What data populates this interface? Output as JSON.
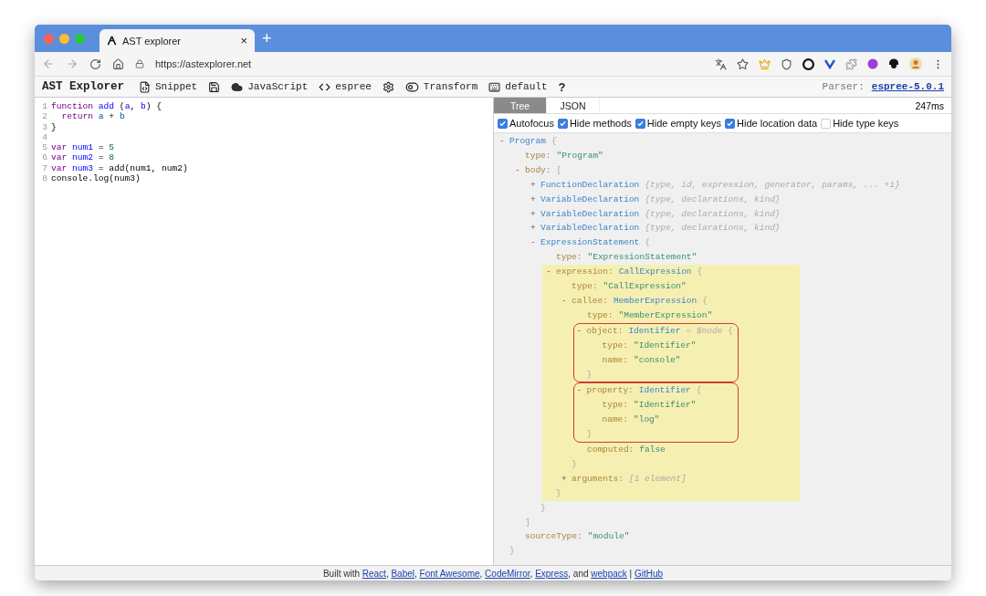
{
  "browser": {
    "tab": {
      "title": "AST explorer",
      "close": "×"
    },
    "new_tab": "+",
    "url": "https://astexplorer.net"
  },
  "toolbar": {
    "title": "AST Explorer",
    "items": [
      {
        "kind": "snippet",
        "label": "Snippet"
      },
      {
        "kind": "save"
      },
      {
        "kind": "language",
        "label": "JavaScript"
      },
      {
        "kind": "parser",
        "label": "espree"
      },
      {
        "kind": "settings"
      },
      {
        "kind": "transform",
        "label": "Transform"
      },
      {
        "kind": "keymap",
        "label": "default"
      },
      {
        "kind": "help",
        "label": "?"
      }
    ],
    "parser_label": "Parser:",
    "parser_link": "espree-5.0.1"
  },
  "editor": {
    "lines": [
      {
        "number": "1",
        "tokens": [
          {
            "kind": "keyword",
            "text": "function "
          },
          {
            "kind": "def",
            "text": "add"
          },
          {
            "kind": "plain",
            "text": " ("
          },
          {
            "kind": "def",
            "text": "a"
          },
          {
            "kind": "plain",
            "text": ", "
          },
          {
            "kind": "def",
            "text": "b"
          },
          {
            "kind": "plain",
            "text": ") {"
          }
        ]
      },
      {
        "number": "2",
        "tokens": [
          {
            "kind": "keyword",
            "text": "  return "
          },
          {
            "kind": "variable",
            "text": "a"
          },
          {
            "kind": "plain",
            "text": " + "
          },
          {
            "kind": "variable",
            "text": "b"
          }
        ]
      },
      {
        "number": "3",
        "tokens": [
          {
            "kind": "plain",
            "text": "}"
          }
        ]
      },
      {
        "number": "4"
      },
      {
        "number": "5",
        "tokens": [
          {
            "kind": "keyword",
            "text": "var "
          },
          {
            "kind": "def",
            "text": "num1"
          },
          {
            "kind": "plain",
            "text": " = "
          },
          {
            "kind": "number",
            "text": "5"
          }
        ]
      },
      {
        "number": "6",
        "tokens": [
          {
            "kind": "keyword",
            "text": "var "
          },
          {
            "kind": "def",
            "text": "num2"
          },
          {
            "kind": "plain",
            "text": " = "
          },
          {
            "kind": "number",
            "text": "8"
          }
        ]
      },
      {
        "number": "7",
        "tokens": [
          {
            "kind": "keyword",
            "text": "var "
          },
          {
            "kind": "def",
            "text": "num3"
          },
          {
            "kind": "plain",
            "text": " = add(num1, num2)"
          }
        ]
      },
      {
        "number": "8",
        "tokens": [
          {
            "kind": "plain",
            "text": "console.log(num3)"
          }
        ]
      }
    ]
  },
  "output": {
    "tabs": [
      {
        "label": "Tree",
        "selected": true
      },
      {
        "label": "JSON",
        "selected": false
      }
    ],
    "time": "247ms",
    "options": [
      {
        "label": "Autofocus",
        "checked": true
      },
      {
        "label": "Hide methods",
        "checked": true
      },
      {
        "label": "Hide empty keys",
        "checked": true
      },
      {
        "label": "Hide location data",
        "checked": true
      },
      {
        "label": "Hide type keys",
        "checked": false
      }
    ],
    "tree": [
      {
        "kind": "node",
        "toggle": "-",
        "expanded": true,
        "type_name": "Program",
        "brace": "{",
        "close": "}",
        "children": [
          {
            "kind": "prop",
            "key": "type:",
            "value": "\"Program\""
          },
          {
            "kind": "node",
            "toggle": "-",
            "expanded": true,
            "key": "body:",
            "brace": "[",
            "close": "]",
            "children": [
              {
                "kind": "node",
                "toggle": "+",
                "expanded": false,
                "type_name": "FunctionDeclaration",
                "summary": "{type, id, expression, generator, params, ... +1}"
              },
              {
                "kind": "node",
                "toggle": "+",
                "expanded": false,
                "type_name": "VariableDeclaration",
                "summary": "{type, declarations, kind}"
              },
              {
                "kind": "node",
                "toggle": "+",
                "expanded": false,
                "type_name": "VariableDeclaration",
                "summary": "{type, declarations, kind}"
              },
              {
                "kind": "node",
                "toggle": "+",
                "expanded": false,
                "type_name": "VariableDeclaration",
                "summary": "{type, declarations, kind}"
              },
              {
                "kind": "node",
                "toggle": "-",
                "expanded": true,
                "type_name": "ExpressionStatement",
                "brace": "{",
                "close": "}",
                "children": [
                  {
                    "kind": "prop",
                    "key": "type:",
                    "value": "\"ExpressionStatement\""
                  },
                  {
                    "kind": "node",
                    "toggle": "-",
                    "expanded": true,
                    "highlighted": true,
                    "key": "expression:",
                    "type_name": "CallExpression",
                    "brace": "{",
                    "close": "}",
                    "children": [
                      {
                        "kind": "prop",
                        "key": "type:",
                        "value": "\"CallExpression\""
                      },
                      {
                        "kind": "node",
                        "toggle": "-",
                        "expanded": true,
                        "key": "callee:",
                        "type_name": "MemberExpression",
                        "brace": "{",
                        "close": "}",
                        "children": [
                          {
                            "kind": "prop",
                            "key": "type:",
                            "value": "\"MemberExpression\""
                          },
                          {
                            "kind": "node",
                            "toggle": "-",
                            "expanded": true,
                            "boxed": true,
                            "key": "object:",
                            "type_name": "Identifier",
                            "annotation": "= $node",
                            "brace": "{",
                            "close": "}",
                            "children": [
                              {
                                "kind": "prop",
                                "key": "type:",
                                "value": "\"Identifier\""
                              },
                              {
                                "kind": "prop",
                                "key": "name:",
                                "value": "\"console\""
                              }
                            ]
                          },
                          {
                            "kind": "node",
                            "toggle": "-",
                            "expanded": true,
                            "boxed": true,
                            "key": "property:",
                            "type_name": "Identifier",
                            "brace": "{",
                            "close": "}",
                            "children": [
                              {
                                "kind": "prop",
                                "key": "type:",
                                "value": "\"Identifier\""
                              },
                              {
                                "kind": "prop",
                                "key": "name:",
                                "value": "\"log\""
                              }
                            ]
                          },
                          {
                            "kind": "prop",
                            "key": "computed:",
                            "value": "false"
                          }
                        ]
                      },
                      {
                        "kind": "node",
                        "toggle": "+",
                        "expanded": false,
                        "key": "arguments:",
                        "summary": "[1 element]"
                      }
                    ]
                  }
                ]
              }
            ]
          },
          {
            "kind": "prop",
            "key": "sourceType:",
            "value": "\"module\""
          }
        ]
      }
    ]
  },
  "footer": {
    "parts": [
      {
        "kind": "text",
        "text": "Built with "
      },
      {
        "kind": "link",
        "text": "React"
      },
      {
        "kind": "text",
        "text": ", "
      },
      {
        "kind": "link",
        "text": "Babel"
      },
      {
        "kind": "text",
        "text": ", "
      },
      {
        "kind": "link",
        "text": "Font Awesome"
      },
      {
        "kind": "text",
        "text": ", "
      },
      {
        "kind": "link",
        "text": "CodeMirror"
      },
      {
        "kind": "text",
        "text": ", "
      },
      {
        "kind": "link",
        "text": "Express"
      },
      {
        "kind": "text",
        "text": ", and "
      },
      {
        "kind": "link",
        "text": "webpack"
      },
      {
        "kind": "text",
        "text": " | "
      },
      {
        "kind": "link",
        "text": "GitHub"
      }
    ]
  }
}
